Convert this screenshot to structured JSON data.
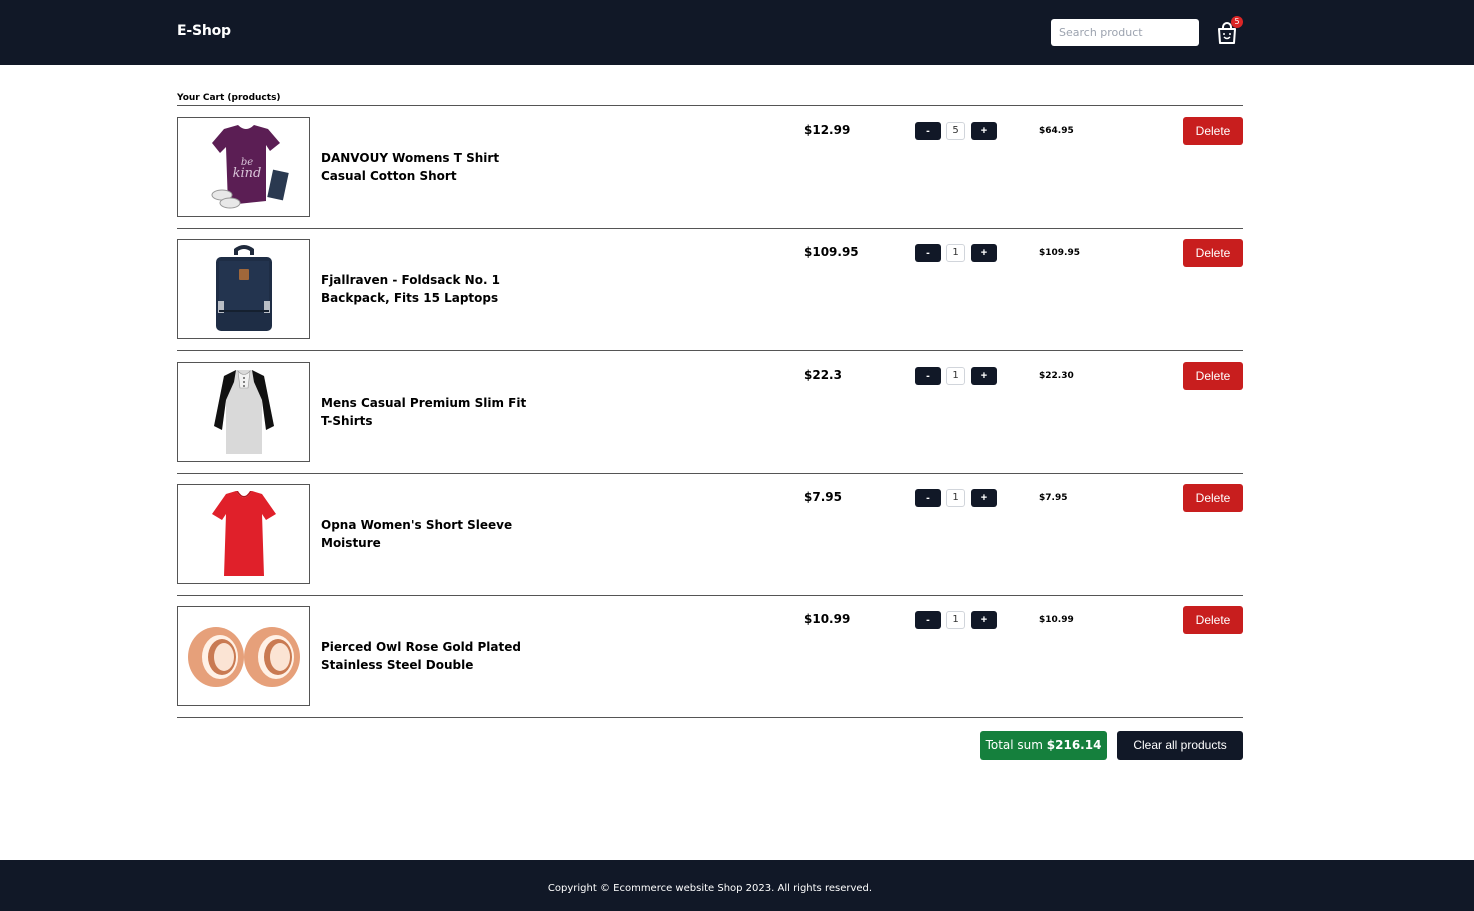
{
  "header": {
    "brand": "E-Shop",
    "search_placeholder": "Search product",
    "cart_count": "5"
  },
  "cart": {
    "title": "Your Cart (products)",
    "items": [
      {
        "name": "DANVOUY Womens T Shirt Casual Cotton Short",
        "price": "$12.99",
        "qty": "5",
        "subtotal": "$64.95",
        "image": "purple-tshirt-image"
      },
      {
        "name": "Fjallraven - Foldsack No. 1 Backpack, Fits 15 Laptops",
        "price": "$109.95",
        "qty": "1",
        "subtotal": "$109.95",
        "image": "navy-backpack-image"
      },
      {
        "name": "Mens Casual Premium Slim Fit T-Shirts",
        "price": "$22.3",
        "qty": "1",
        "subtotal": "$22.30",
        "image": "raglan-shirt-image"
      },
      {
        "name": "Opna Women's Short Sleeve Moisture",
        "price": "$7.95",
        "qty": "1",
        "subtotal": "$7.95",
        "image": "red-vneck-image"
      },
      {
        "name": "Pierced Owl Rose Gold Plated Stainless Steel Double",
        "price": "$10.99",
        "qty": "1",
        "subtotal": "$10.99",
        "image": "rose-gold-plugs-image"
      }
    ],
    "minus_label": "-",
    "plus_label": "+",
    "delete_label": "Delete",
    "total_label": "Total sum",
    "total_value": "$216.14",
    "clear_label": "Clear all products"
  },
  "footer": {
    "copyright": "Copyright © Ecommerce website Shop 2023. All rights reserved."
  },
  "colors": {
    "nav_bg": "#111827",
    "delete": "#c81e1e",
    "total": "#15803d",
    "badge": "#dc2626"
  }
}
